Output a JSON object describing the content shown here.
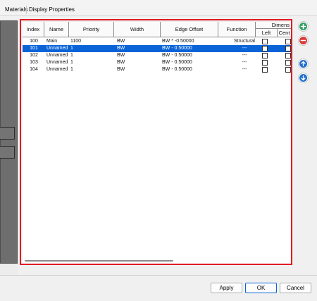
{
  "tabs": {
    "materials": "Materials",
    "display_properties": "Display Properties"
  },
  "table": {
    "columns": {
      "index": "Index",
      "name": "Name",
      "priority": "Priority",
      "width": "Width",
      "edge_offset": "Edge Offset",
      "function": "Function",
      "dimension_group": "Dimens",
      "dim_left": "Left",
      "dim_center": "Cent"
    },
    "rows": [
      {
        "index": "100",
        "name": "Main",
        "priority": "1100",
        "width": "BW",
        "edge_offset": "BW * -0.50000",
        "function": "Structural",
        "selected": false
      },
      {
        "index": "101",
        "name": "Unnamed",
        "priority": "1",
        "width": "BW",
        "edge_offset": "BW - 0.50000",
        "function": "---",
        "selected": true
      },
      {
        "index": "102",
        "name": "Unnamed",
        "priority": "1",
        "width": "BW",
        "edge_offset": "BW - 0.50000",
        "function": "---",
        "selected": false
      },
      {
        "index": "103",
        "name": "Unnamed",
        "priority": "1",
        "width": "BW",
        "edge_offset": "BW - 0.50000",
        "function": "---",
        "selected": false
      },
      {
        "index": "104",
        "name": "Unnamed",
        "priority": "1",
        "width": "BW",
        "edge_offset": "BW - 0.50000",
        "function": "---",
        "selected": false
      }
    ]
  },
  "side_buttons": {
    "add": "plus-circle-icon",
    "remove": "minus-circle-icon",
    "move_up": "arrow-up-circle-icon",
    "move_down": "arrow-down-circle-icon"
  },
  "footer": {
    "apply_label": "Apply",
    "ok_label": "OK",
    "cancel_label": "Cancel"
  },
  "colors": {
    "highlight_border": "#e01b24",
    "selection": "#0a64d8",
    "add_icon": "#2e9d63",
    "remove_icon": "#d83b3b",
    "arrow_icon": "#1e6fd0"
  }
}
